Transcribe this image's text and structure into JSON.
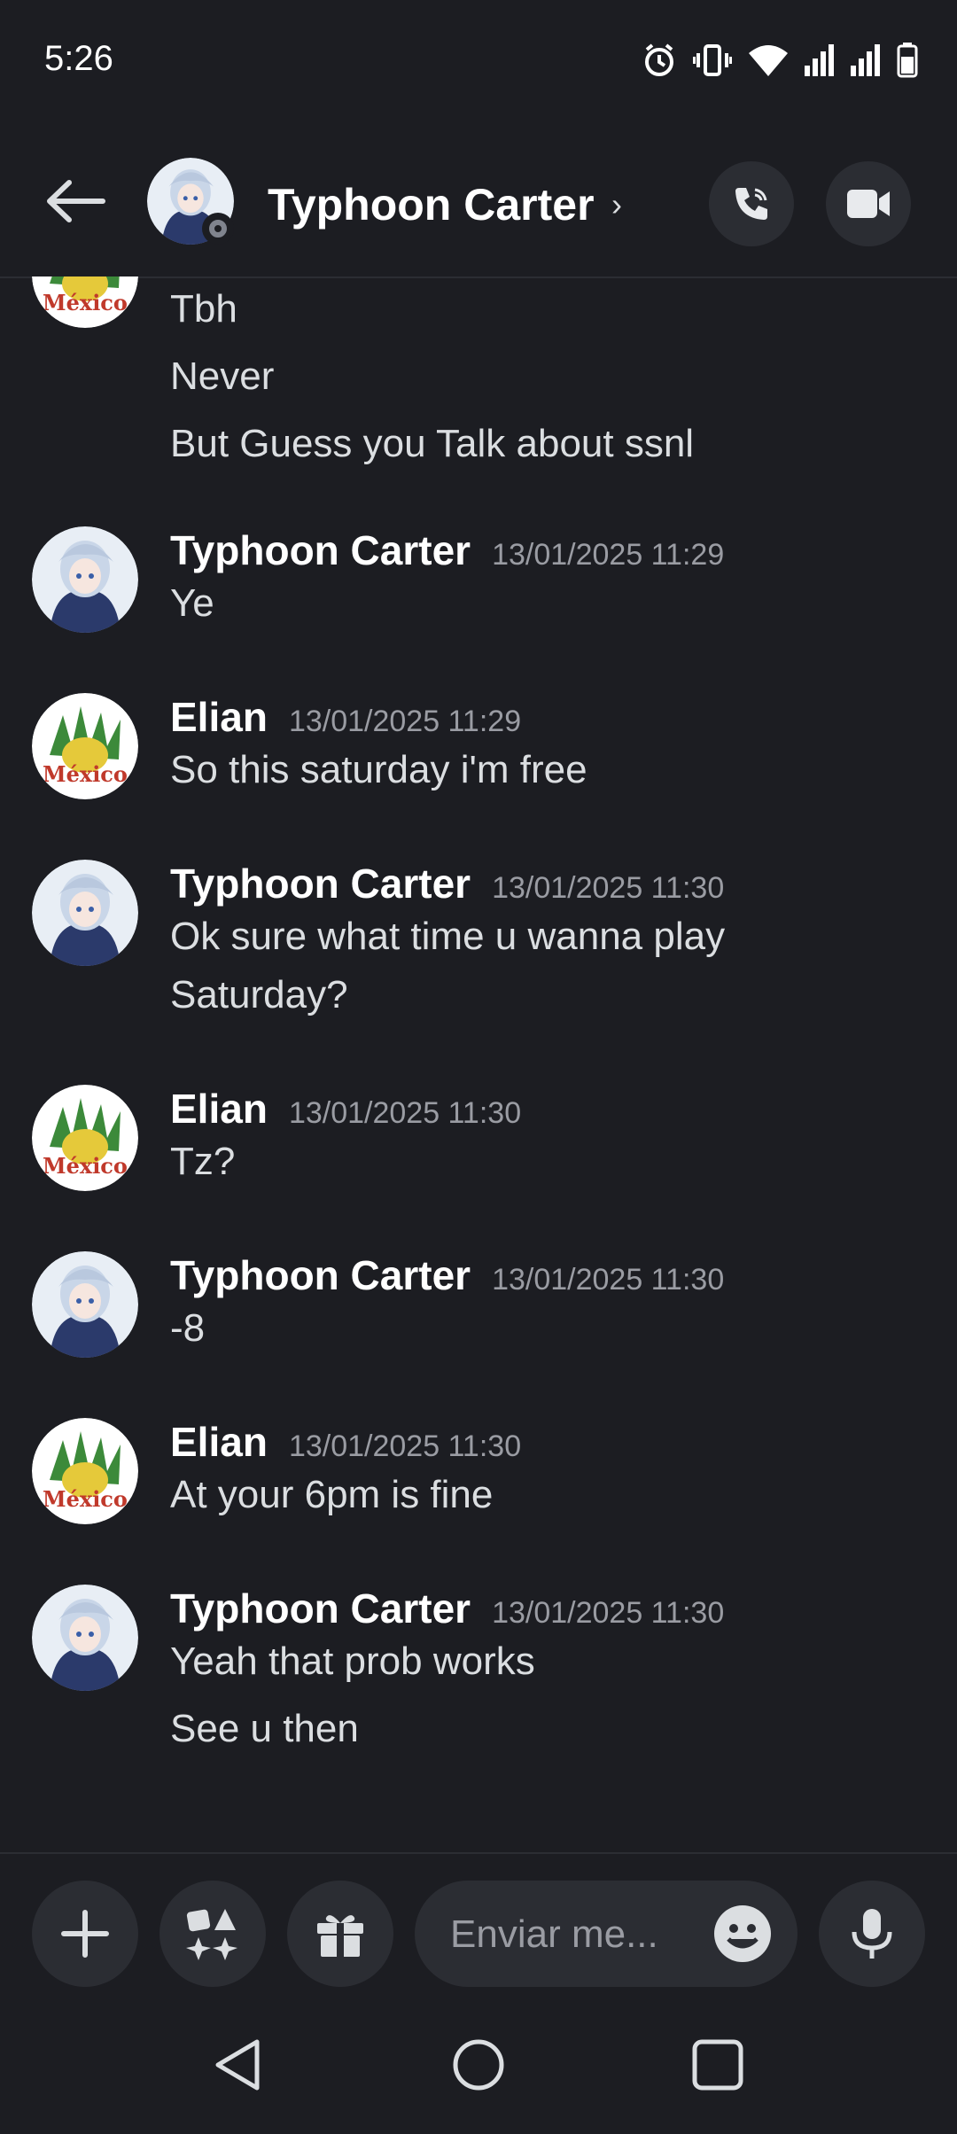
{
  "status_bar": {
    "time": "5:26"
  },
  "header": {
    "contact_name": "Typhoon Carter"
  },
  "messages": [
    {
      "author": "",
      "timestamp": "",
      "avatar": "mexico-avatar",
      "lines": [
        "Tbh",
        "Never",
        "But Guess you Talk about ssnl"
      ]
    },
    {
      "author": "Typhoon Carter",
      "timestamp": "13/01/2025 11:29",
      "avatar": "anime-avatar",
      "lines": [
        "Ye"
      ]
    },
    {
      "author": "Elian",
      "timestamp": "13/01/2025 11:29",
      "avatar": "mexico-avatar",
      "lines": [
        "So this saturday i'm free"
      ]
    },
    {
      "author": "Typhoon Carter",
      "timestamp": "13/01/2025 11:30",
      "avatar": "anime-avatar",
      "lines": [
        "Ok sure what time u wanna play",
        "Saturday?"
      ]
    },
    {
      "author": "Elian",
      "timestamp": "13/01/2025 11:30",
      "avatar": "mexico-avatar",
      "lines": [
        "Tz?"
      ]
    },
    {
      "author": "Typhoon Carter",
      "timestamp": "13/01/2025 11:30",
      "avatar": "anime-avatar",
      "lines": [
        "-8"
      ]
    },
    {
      "author": "Elian",
      "timestamp": "13/01/2025 11:30",
      "avatar": "mexico-avatar",
      "lines": [
        "At your 6pm is fine"
      ]
    },
    {
      "author": "Typhoon Carter",
      "timestamp": "13/01/2025 11:30",
      "avatar": "anime-avatar",
      "lines": [
        "Yeah that prob works",
        "See u then"
      ]
    }
  ],
  "avatar_text": {
    "mexico": "México"
  },
  "composer": {
    "placeholder": "Enviar me..."
  },
  "colors": {
    "background": "#1c1d22",
    "surface": "#2b2d33",
    "muted": "#9a9ca3"
  }
}
